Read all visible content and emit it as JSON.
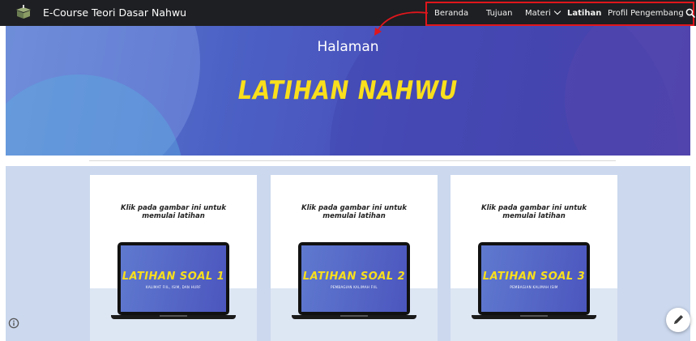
{
  "header": {
    "site_title": "E-Course Teori Dasar Nahwu",
    "logo": "book-logo-icon",
    "nav": [
      {
        "label": "Beranda"
      },
      {
        "label": "Tujuan"
      },
      {
        "label": "Materi",
        "has_dropdown": true
      },
      {
        "label": "Latihan",
        "active": true
      },
      {
        "label": "Profil Pengembang"
      }
    ],
    "search_icon": "search-icon",
    "highlight_color": "#e0161c"
  },
  "hero": {
    "subtitle": "Halaman",
    "title": "LATIHAN NAHWU",
    "title_color": "#f9df1c"
  },
  "cards": [
    {
      "caption_line1": "Klik pada gambar ini untuk",
      "caption_line2": "memulai latihan",
      "screen_title": "LATIHAN SOAL 1",
      "screen_subtitle": "KALIMAT FIIL, ISIM, DAN HURF"
    },
    {
      "caption_line1": "Klik pada gambar ini untuk",
      "caption_line2": "memulai latihan",
      "screen_title": "LATIHAN SOAL 2",
      "screen_subtitle": "PEMBAGIAN KALIMAH FIIL"
    },
    {
      "caption_line1": "Klik pada gambar ini untuk",
      "caption_line2": "memulai latihan",
      "screen_title": "LATIHAN SOAL 3",
      "screen_subtitle": "PEMBAGIAN KALIMAH ISIM"
    }
  ],
  "floating": {
    "info_icon": "info-icon",
    "edit_icon": "pencil-icon"
  }
}
